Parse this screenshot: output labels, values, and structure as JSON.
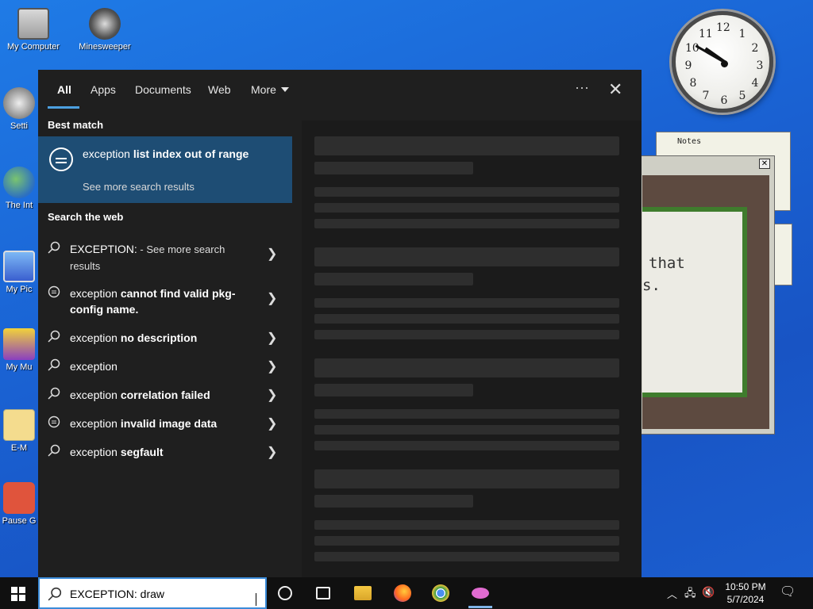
{
  "desktop": {
    "icons": [
      {
        "label": "My Computer",
        "icon": "computer-icon"
      },
      {
        "label": "Minesweeper",
        "icon": "mine-icon"
      },
      {
        "label": "Setti",
        "icon": "gear-icon"
      },
      {
        "label": "The Int",
        "icon": "globe-icon"
      },
      {
        "label": "My Pic",
        "icon": "pictures-icon"
      },
      {
        "label": "My Mu",
        "icon": "music-icon"
      },
      {
        "label": "E-M",
        "icon": "mail-icon"
      },
      {
        "label": "Pause G",
        "icon": "power-icon"
      }
    ],
    "clock_numbers": [
      "12",
      "1",
      "2",
      "3",
      "4",
      "5",
      "6",
      "7",
      "8",
      "9",
      "10",
      "11"
    ],
    "notes_title": "Notes",
    "game_text_1": "that",
    "game_text_2": "s."
  },
  "search": {
    "tabs": [
      {
        "label": "All",
        "active": true
      },
      {
        "label": "Apps"
      },
      {
        "label": "Documents"
      },
      {
        "label": "Web"
      },
      {
        "label": "More"
      }
    ],
    "more_icon": "ellipsis-icon",
    "close_icon": "close-icon",
    "best_match_heading": "Best match",
    "best_match": {
      "prefix": "exception ",
      "bold": "list index out of range",
      "subtitle": "See more search results",
      "icon": "chat-bubble-icon"
    },
    "web_heading": "Search the web",
    "web_results": [
      {
        "prefix": "EXCEPTION:",
        "bold": "",
        "suffix": " - See more search results",
        "icon": "search-icon"
      },
      {
        "prefix": "exception ",
        "bold": "cannot find valid pkg-config name.",
        "suffix": "",
        "icon": "chat-bubble-icon"
      },
      {
        "prefix": "exception ",
        "bold": "no description",
        "suffix": "",
        "icon": "search-icon"
      },
      {
        "prefix": "exception",
        "bold": "",
        "suffix": "",
        "icon": "search-icon"
      },
      {
        "prefix": "exception ",
        "bold": "correlation failed",
        "suffix": "",
        "icon": "search-icon"
      },
      {
        "prefix": "exception ",
        "bold": "invalid image data",
        "suffix": "",
        "icon": "chat-bubble-icon"
      },
      {
        "prefix": "exception ",
        "bold": "segfault",
        "suffix": "",
        "icon": "search-icon"
      }
    ]
  },
  "taskbar": {
    "search_value": "EXCEPTION: draw",
    "time": "10:50 PM",
    "date": "5/7/2024",
    "apps": [
      "cortana-icon",
      "task-view-icon",
      "file-explorer-icon",
      "firefox-icon",
      "chrome-icon",
      "app-icon"
    ]
  }
}
